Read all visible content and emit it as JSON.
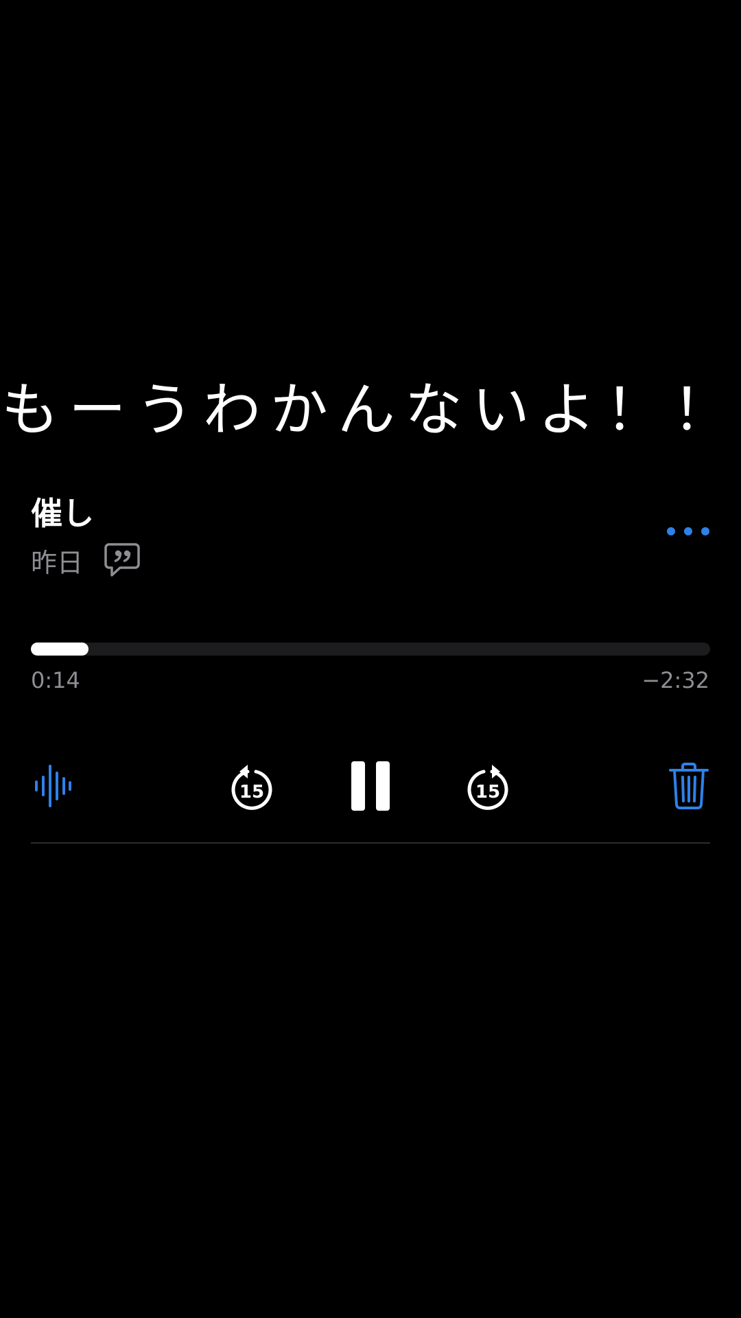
{
  "overlay": {
    "text": "もーうわかんないよ！！"
  },
  "recording": {
    "title": "催し",
    "date": "昨日",
    "transcript_icon": "quote-bubble-icon",
    "more_icon": "ellipsis-icon"
  },
  "playback": {
    "elapsed": "0:14",
    "remaining": "−2:32",
    "progress_fraction": 0.085
  },
  "controls": {
    "waveform_icon": "waveform-icon",
    "skip_back_icon": "skip-back-15-icon",
    "skip_back_seconds": "15",
    "pause_icon": "pause-icon",
    "skip_forward_icon": "skip-forward-15-icon",
    "skip_forward_seconds": "15",
    "delete_icon": "trash-icon"
  },
  "colors": {
    "accent": "#2f81e8",
    "background": "#000000",
    "secondary_text": "#8e8e93",
    "track": "#1c1c1e"
  }
}
